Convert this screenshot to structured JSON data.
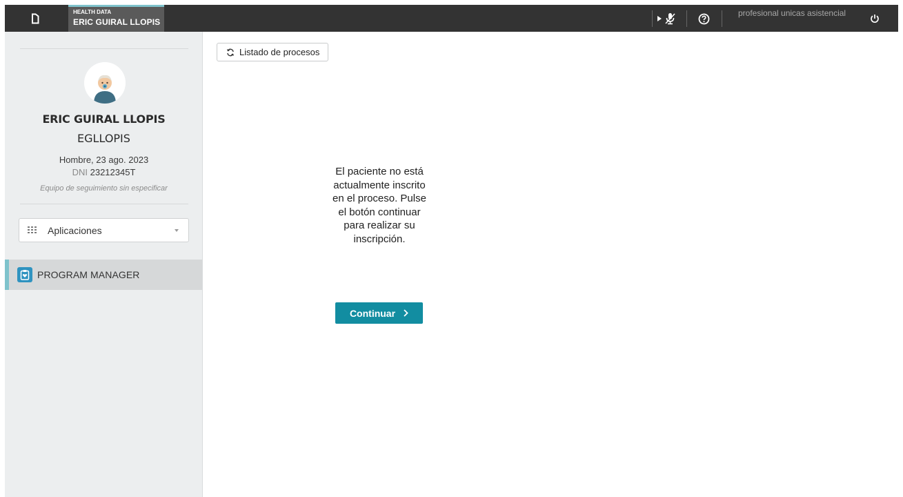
{
  "topbar": {
    "app_label": "HEALTH DATA",
    "patient_name": "ERIC GUIRAL LLOPIS",
    "user_name": "profesional unicas asistencial",
    "icons": [
      "app-logo-icon",
      "play-icon",
      "microphone-off-icon",
      "help-icon",
      "power-icon"
    ]
  },
  "sidebar": {
    "patient": {
      "name": "ERIC GUIRAL LLOPIS",
      "username": "EGLLOPIS",
      "info": "Hombre, 23 ago. 2023",
      "dni_label": "DNI",
      "dni_value": "23212345T",
      "team": "Equipo de seguimiento sin especificar"
    },
    "apps_label": "Aplicaciones",
    "program_manager_label": "PROGRAM MANAGER"
  },
  "main": {
    "listado_label": "Listado de procesos",
    "message": "El paciente no está actualmente inscrito en el proceso. Pulse el botón continuar para realizar su inscripción.",
    "continue_label": "Continuar",
    "continue_color": "#128da1"
  },
  "colors": {
    "topbar": "#333333",
    "accent": "#7fc3cc",
    "sidebar": "#eceeef",
    "program_manager_icon": "#2f93c0"
  }
}
